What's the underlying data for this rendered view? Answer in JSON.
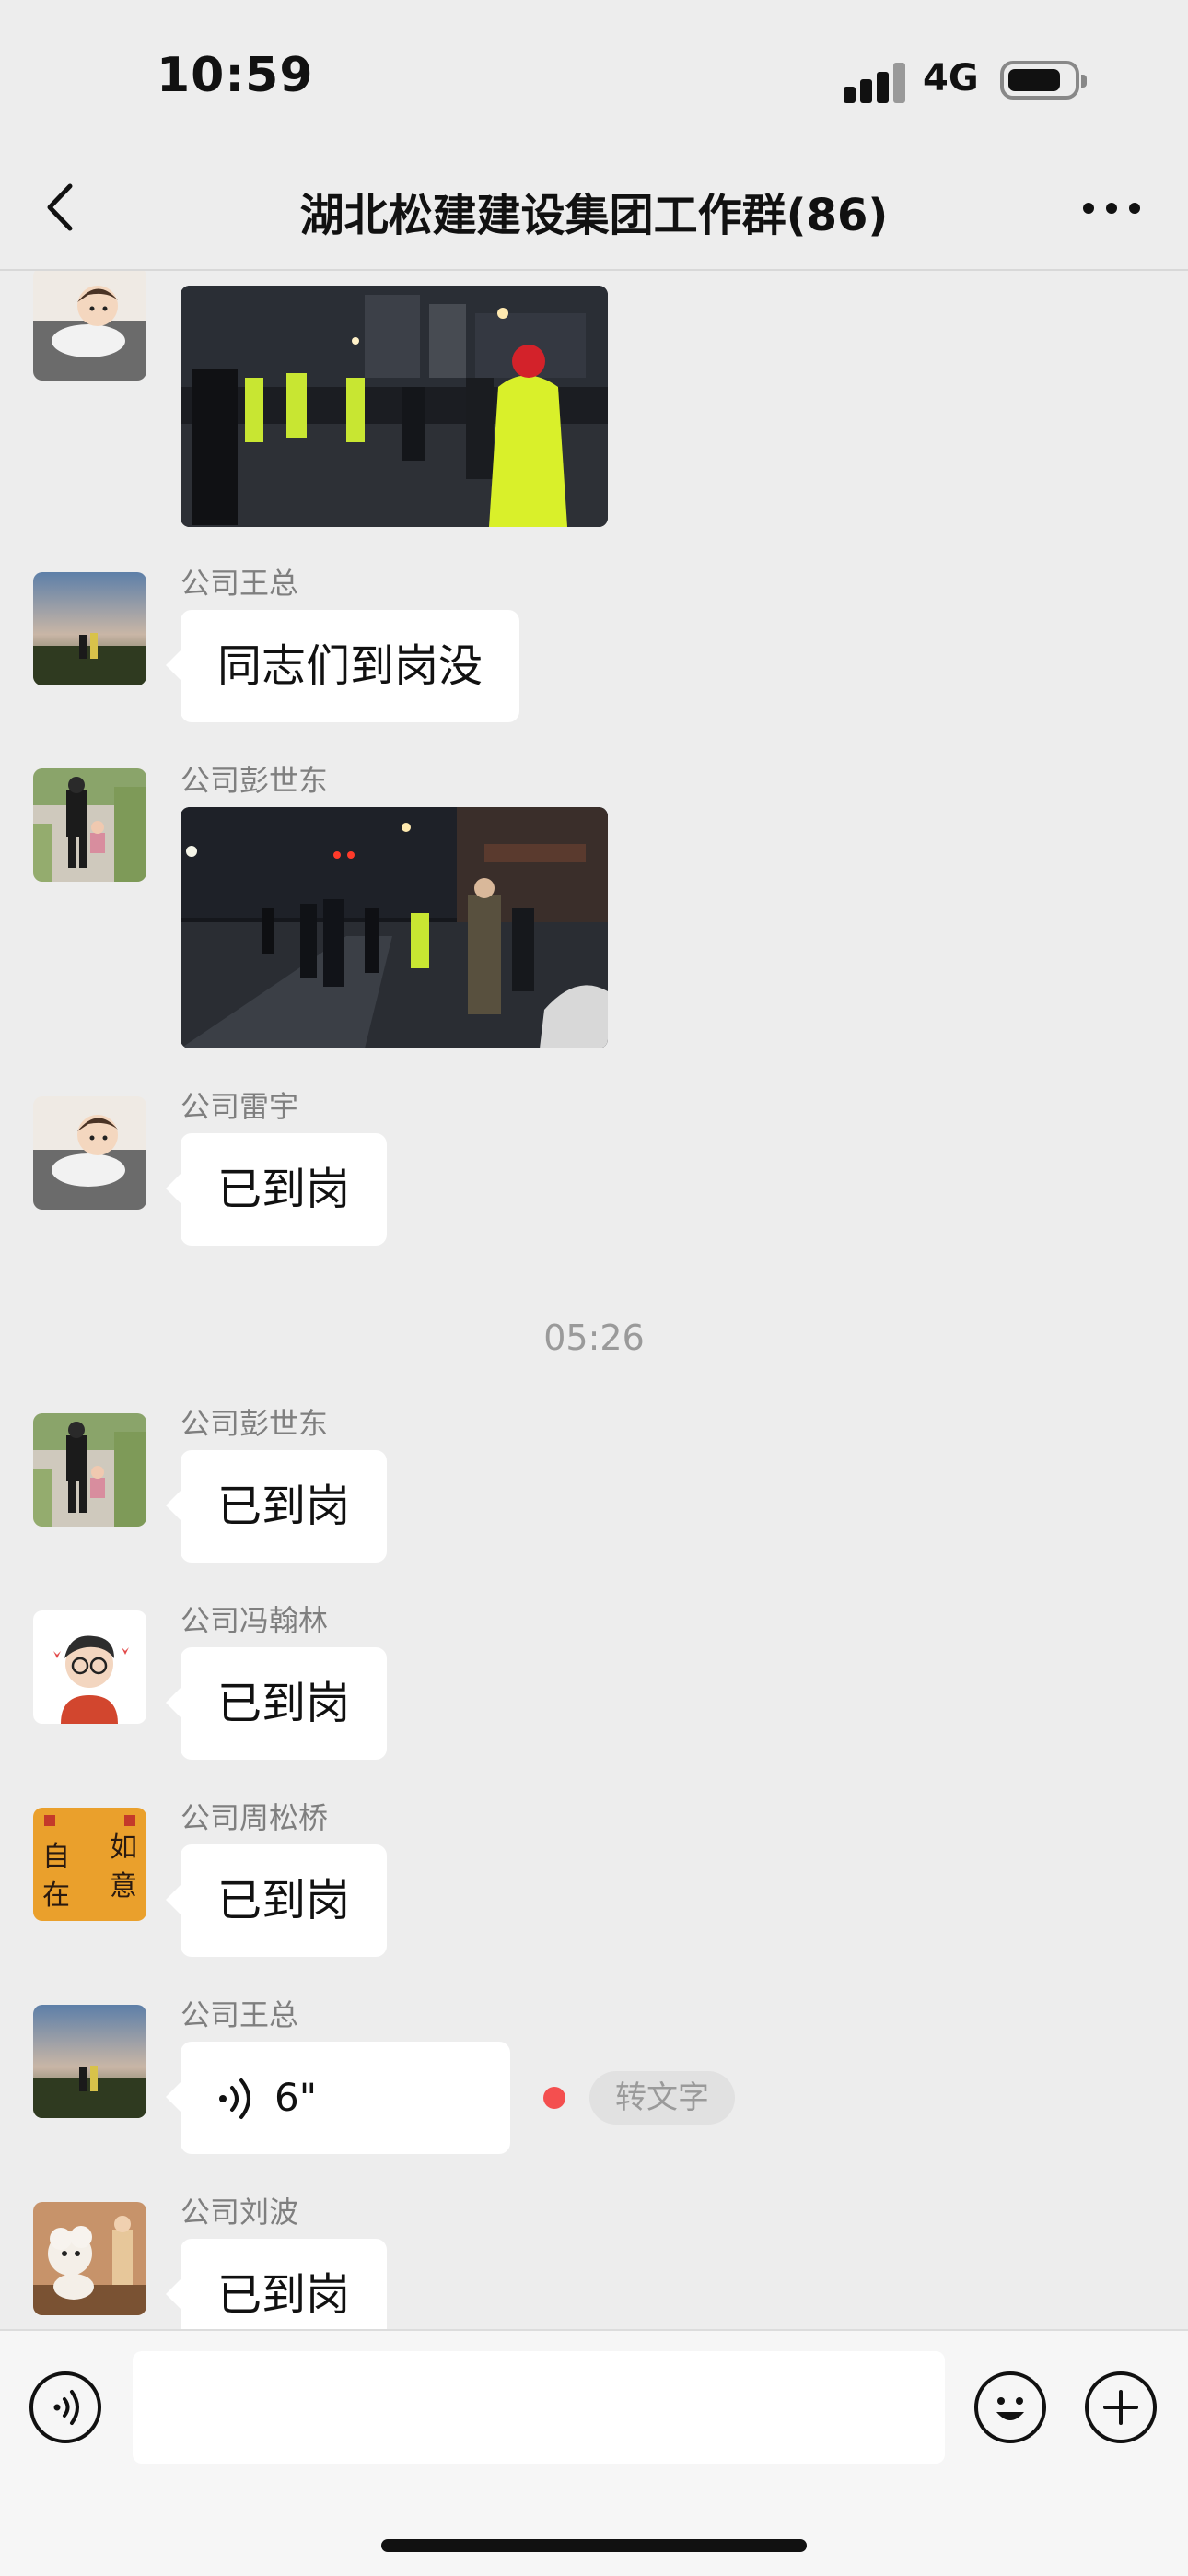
{
  "status_bar": {
    "time": "10:59",
    "network": "4G",
    "icons": [
      "signal-icon",
      "battery-icon"
    ]
  },
  "header": {
    "title": "湖北松建建设集团工作群(86)",
    "icons": [
      "back-icon",
      "more-icon"
    ]
  },
  "messages": [
    {
      "type": "image",
      "sender": "",
      "avatar": "cartoon-boy-avatar"
    },
    {
      "type": "text",
      "sender": "公司王总",
      "text": "同志们到岗没",
      "avatar": "sunset-landscape-avatar"
    },
    {
      "type": "image",
      "sender": "公司彭世东",
      "avatar": "parent-child-walk-avatar"
    },
    {
      "type": "text",
      "sender": "公司雷宇",
      "text": "已到岗",
      "avatar": "cartoon-boy-avatar"
    },
    {
      "type": "timestamp",
      "text": "05:26"
    },
    {
      "type": "text",
      "sender": "公司彭世东",
      "text": "已到岗",
      "avatar": "parent-child-walk-avatar"
    },
    {
      "type": "text",
      "sender": "公司冯翰林",
      "text": "已到岗",
      "avatar": "cartoon-glasses-man-avatar"
    },
    {
      "type": "text",
      "sender": "公司周松桥",
      "text": "已到岗",
      "avatar": "calligraphy-avatar",
      "avatar_text": [
        "自",
        "在",
        "如",
        "意"
      ]
    },
    {
      "type": "voice",
      "sender": "公司王总",
      "duration": "6\"",
      "action": "转文字",
      "avatar": "sunset-landscape-avatar"
    },
    {
      "type": "text",
      "sender": "公司刘波",
      "text": "已到岗",
      "avatar": "poodle-dog-avatar"
    }
  ],
  "input_bar": {
    "icons": [
      "voice-input-icon",
      "emoji-icon",
      "plus-icon"
    ],
    "value": ""
  },
  "colors": {
    "background": "#ededed",
    "bubble": "#ffffff",
    "unread_dot": "#f44f4f"
  }
}
